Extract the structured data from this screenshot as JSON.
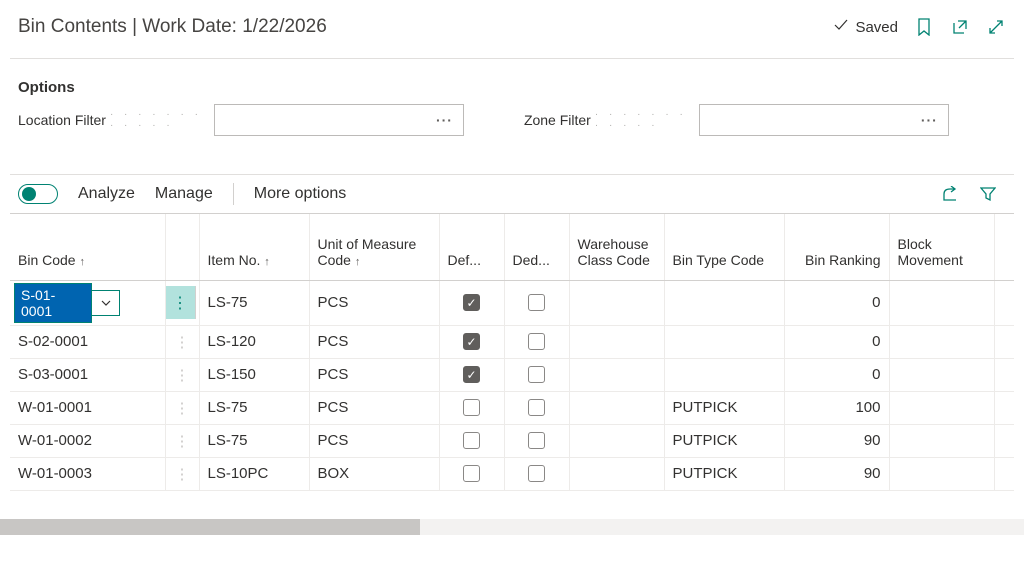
{
  "header": {
    "title": "Bin Contents | Work Date: 1/22/2026",
    "saved": "Saved"
  },
  "options": {
    "section_title": "Options",
    "location_filter_label": "Location Filter",
    "location_filter_value": "",
    "zone_filter_label": "Zone Filter",
    "zone_filter_value": ""
  },
  "toolbar": {
    "analyze": "Analyze",
    "manage": "Manage",
    "more": "More options"
  },
  "columns": {
    "bin_code": "Bin Code",
    "item_no": "Item No.",
    "uom": "Unit of Measure Code",
    "def": "Def...",
    "ded": "Ded...",
    "warehouse_class": "Warehouse Class Code",
    "bin_type": "Bin Type Code",
    "bin_ranking": "Bin Ranking",
    "block_movement": "Block Movement"
  },
  "rows": [
    {
      "bin_code": "S-01-0001",
      "item_no": "LS-75",
      "uom": "PCS",
      "def": true,
      "ded": false,
      "warehouse_class": "",
      "bin_type": "",
      "bin_ranking": "0",
      "block_movement": ""
    },
    {
      "bin_code": "S-02-0001",
      "item_no": "LS-120",
      "uom": "PCS",
      "def": true,
      "ded": false,
      "warehouse_class": "",
      "bin_type": "",
      "bin_ranking": "0",
      "block_movement": ""
    },
    {
      "bin_code": "S-03-0001",
      "item_no": "LS-150",
      "uom": "PCS",
      "def": true,
      "ded": false,
      "warehouse_class": "",
      "bin_type": "",
      "bin_ranking": "0",
      "block_movement": ""
    },
    {
      "bin_code": "W-01-0001",
      "item_no": "LS-75",
      "uom": "PCS",
      "def": false,
      "ded": false,
      "warehouse_class": "",
      "bin_type": "PUTPICK",
      "bin_ranking": "100",
      "block_movement": ""
    },
    {
      "bin_code": "W-01-0002",
      "item_no": "LS-75",
      "uom": "PCS",
      "def": false,
      "ded": false,
      "warehouse_class": "",
      "bin_type": "PUTPICK",
      "bin_ranking": "90",
      "block_movement": ""
    },
    {
      "bin_code": "W-01-0003",
      "item_no": "LS-10PC",
      "uom": "BOX",
      "def": false,
      "ded": false,
      "warehouse_class": "",
      "bin_type": "PUTPICK",
      "bin_ranking": "90",
      "block_movement": ""
    }
  ],
  "selected_row_index": 0
}
